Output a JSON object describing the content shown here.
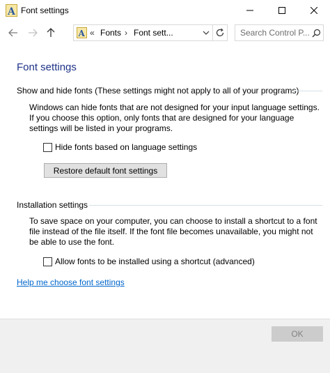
{
  "window": {
    "title": "Font settings",
    "app_icon": "font-a-icon"
  },
  "nav": {
    "address_prefix": "«",
    "breadcrumbs": [
      "Fonts",
      "Font sett..."
    ],
    "separator": "›",
    "search_placeholder": "Search Control P..."
  },
  "content": {
    "title": "Font settings",
    "show_hide": {
      "heading": "Show and hide fonts (These settings might not apply to all of your programs)",
      "description": "Windows can hide fonts that are not designed for your input language settings. If you choose this option, only fonts that are designed for your language settings will be listed in your programs.",
      "checkbox_label": "Hide fonts based on language settings",
      "checkbox_checked": false,
      "restore_button": "Restore default font settings"
    },
    "installation": {
      "heading": "Installation settings",
      "description": "To save space on your computer, you can choose to install a shortcut to a font file instead of the file itself. If the font file becomes unavailable, you might not be able to use the font.",
      "checkbox_label": "Allow fonts to be installed using a shortcut (advanced)",
      "checkbox_checked": false
    },
    "help_link": "Help me choose font settings"
  },
  "footer": {
    "ok_label": "OK",
    "ok_disabled": true
  },
  "colors": {
    "title_blue": "#1e3287",
    "link_blue": "#0066cc",
    "footer_bg": "#f0f0f0"
  }
}
